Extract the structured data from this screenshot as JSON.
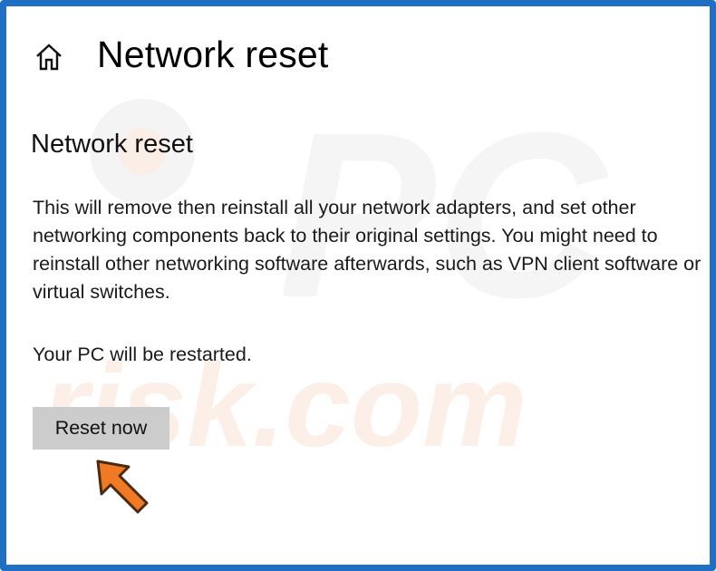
{
  "header": {
    "title": "Network reset",
    "home_icon": "home-icon"
  },
  "section": {
    "title": "Network reset",
    "description": "This will remove then reinstall all your network adapters, and set other networking components back to their original settings. You might need to reinstall other networking software afterwards, such as VPN client software or virtual switches.",
    "restart_note": "Your PC will be restarted."
  },
  "actions": {
    "reset_label": "Reset now"
  },
  "watermark": {
    "line1": "PC",
    "line2": "risk.com"
  },
  "colors": {
    "frame_border": "#1f6fc5",
    "button_bg": "#cccccc",
    "arrow": "#f07a24"
  }
}
